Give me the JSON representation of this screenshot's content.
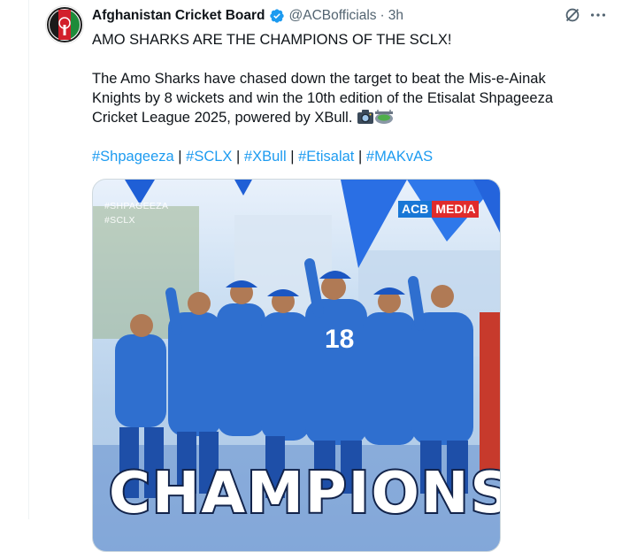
{
  "tweet": {
    "author_name": "Afghanistan Cricket Board",
    "handle": "@ACBofficials",
    "separator": "·",
    "timestamp": "3h",
    "headline": "AMO SHARKS ARE THE CHAMPIONS OF THE SCLX!",
    "body": "The Amo Sharks have chased down the target to beat the Mis-e-Ainak Knights by 8 wickets and win the 10th edition of the Etisalat Shpageeza Cricket League 2025, powered by XBull.",
    "hashtags": [
      "#Shpageeza",
      "#SCLX",
      "#XBull",
      "#Etisalat",
      "#MAKvAS"
    ],
    "hashtag_separator": "|",
    "emojis": [
      "camera-flash-emoji",
      "stadium-emoji"
    ]
  },
  "media": {
    "watermark_tags": [
      "#SHPAGEEZA",
      "#SCLX"
    ],
    "logo_part_a": "ACB",
    "logo_part_b": "MEDIA",
    "banner_text": "CHAMPIONS",
    "jersey_number": "18"
  },
  "icons": {
    "verified": "verified-badge-icon",
    "grok": "grok-icon",
    "more": "more-options-icon"
  },
  "colors": {
    "link": "#1d9bf0",
    "verified": "#1d9bf0",
    "secondary_text": "#536471",
    "jersey": "#2f6fcf"
  }
}
